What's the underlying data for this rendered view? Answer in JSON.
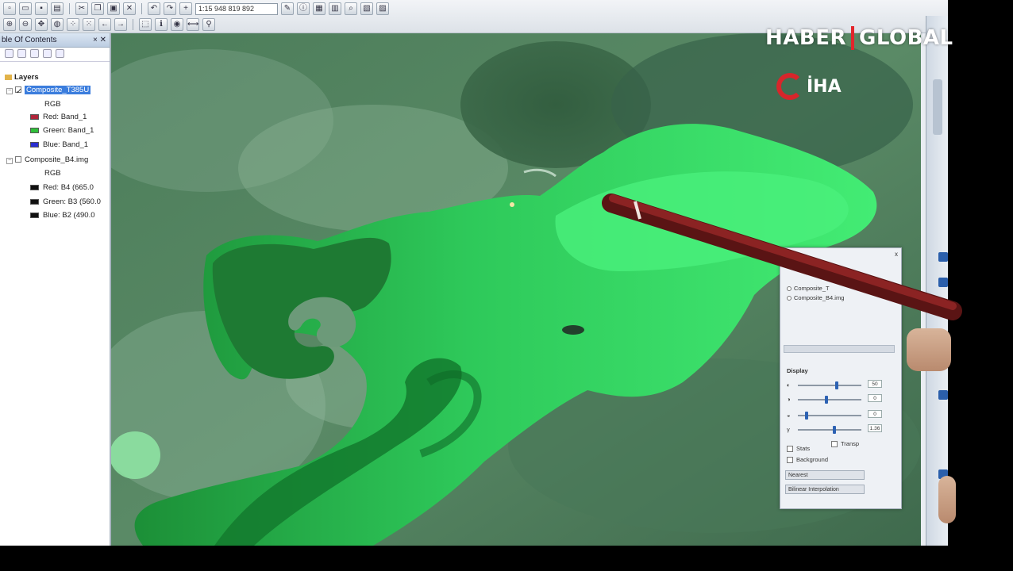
{
  "toolbar": {
    "scale_value": "1:15 948 819 892"
  },
  "toc": {
    "title": "ble Of Contents",
    "close_glyph": "× ✕",
    "root_label": "Layers",
    "layers": [
      {
        "name": "Composite_T385U",
        "selected": true,
        "mode": "RGB",
        "bands": [
          {
            "label": "Red:   Band_1",
            "color": "#b0253a"
          },
          {
            "label": "Green:  Band_1",
            "color": "#2fbf3a"
          },
          {
            "label": "Blue:   Band_1",
            "color": "#2a2fd1"
          }
        ]
      },
      {
        "name": "Composite_B4.img",
        "selected": false,
        "mode": "RGB",
        "bands": [
          {
            "label": "Red:    B4 (665.0",
            "color": "#111111"
          },
          {
            "label": "Green: B3 (560.0",
            "color": "#111111"
          },
          {
            "label": "Blue:   B2 (490.0",
            "color": "#111111"
          }
        ]
      }
    ]
  },
  "dialog": {
    "close_glyph": "x",
    "layer_options": [
      "Composite_T",
      "Composite_B4.img"
    ],
    "section_title": "Display",
    "sliders": [
      {
        "label": "◐",
        "value_text": "50",
        "level": 0.62
      },
      {
        "label": "◑",
        "value_text": "0",
        "level": 0.45
      },
      {
        "label": "◒",
        "value_text": "0",
        "level": 0.12
      },
      {
        "label": "γ",
        "value_text": "1.36",
        "level": 0.58
      }
    ],
    "checkboxes": [
      {
        "label": "Stats"
      },
      {
        "label": "Transp"
      },
      {
        "label": "Background"
      }
    ],
    "combo_1": "Nearest",
    "combo_2": "Bilinear Interpolation"
  },
  "overlay": {
    "brand_left": "HABER",
    "brand_right": "GLOBAL",
    "agency": "İHA"
  },
  "colors": {
    "water_bloom": "#34e067",
    "water_deep": "#1d9f3c",
    "land": "#3d6b4c",
    "brand_red": "#e3262c"
  }
}
